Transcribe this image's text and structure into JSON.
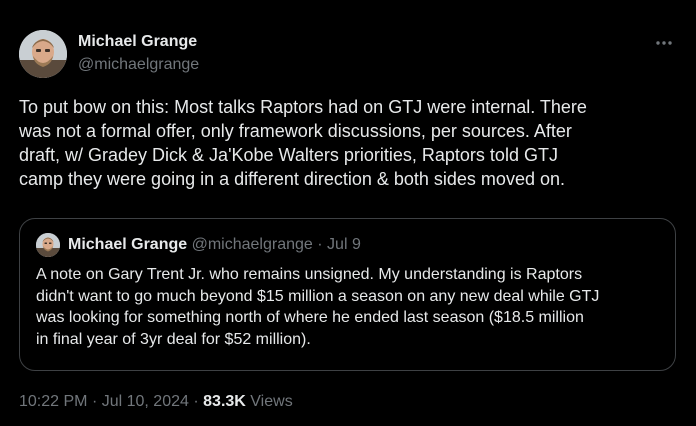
{
  "author": {
    "name": "Michael Grange",
    "handle": "@michaelgrange"
  },
  "tweet": {
    "text": "To put bow on this: Most talks Raptors had on GTJ were internal. There\nwas not a formal offer, only framework discussions, per sources. After\ndraft, w/ Gradey Dick &  Ja'Kobe Walters priorities, Raptors told GTJ\ncamp they were going in a different direction & both sides moved on."
  },
  "quote": {
    "name": "Michael Grange",
    "handle": "@michaelgrange",
    "separator": "·",
    "date": "Jul 9",
    "text": "A note on Gary Trent Jr. who remains unsigned. My understanding is Raptors\ndidn't want to go much beyond $15 million a season on any new deal while GTJ\nwas looking for something north of where he ended last season ($18.5 million\nin final year of 3yr deal for $52 million)."
  },
  "meta": {
    "time": "10:22 PM",
    "separator1": "·",
    "date": "Jul 10, 2024",
    "separator2": "·",
    "views_count": "83.3K",
    "views_label": "Views"
  },
  "icons": {
    "more": "more-horizontal-icon"
  },
  "colors": {
    "background": "#000000",
    "primary_text": "#e7e9ea",
    "secondary_text": "#71767b",
    "border": "#3e4144"
  }
}
